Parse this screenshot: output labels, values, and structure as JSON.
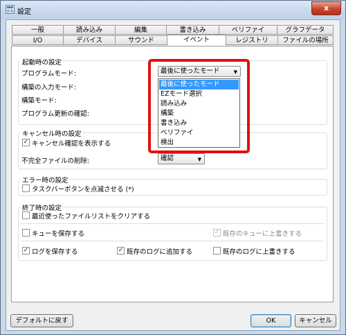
{
  "window": {
    "title": "設定",
    "close_label": "x"
  },
  "tabs_row1": [
    "一般",
    "読み込み",
    "編集",
    "書き込み",
    "ベリファイ",
    "グラフデータ"
  ],
  "tabs_row2": [
    "I/O",
    "デバイス",
    "サウンド",
    "イベント",
    "レジストリ",
    "ファイルの場所"
  ],
  "active_tab": "イベント",
  "startup": {
    "title": "起動時の設定",
    "program_mode_label": "プログラムモード:",
    "program_mode_value": "最後に使ったモード",
    "edit_input_mode_label": "構築の入力モード:",
    "edit_mode_label": "構築モード:",
    "program_update_label": "プログラム更新の確認:"
  },
  "dropdown_options": [
    "最後に使ったモード",
    "EZモード選択",
    "読み込み",
    "構築",
    "書き込み",
    "ベリファイ",
    "検出"
  ],
  "dropdown_selected": 0,
  "cancel": {
    "title": "キャンセル時の設定",
    "show_confirm_label": "キャンセル確認を表示する",
    "show_confirm_checked": true,
    "delete_incomplete_label": "不完全ファイルの削除:",
    "delete_incomplete_value": "確認"
  },
  "error": {
    "title": "エラー時の設定",
    "flash_taskbar_label": "タスクバーボタンを点滅させる (*)",
    "flash_taskbar_checked": false
  },
  "exit": {
    "title": "終了時の設定",
    "clear_recent_label": "最近使ったファイルリストをクリアする",
    "clear_recent_checked": false,
    "save_queue_label": "キューを保存する",
    "save_queue_checked": false,
    "overwrite_queue_label": "既存のキューに上書きする",
    "overwrite_queue_checked": true,
    "save_log_label": "ログを保存する",
    "save_log_checked": true,
    "append_log_label": "既存のログに追加する",
    "append_log_checked": true,
    "overwrite_log_label": "既存のログに上書きする",
    "overwrite_log_checked": false
  },
  "buttons": {
    "defaults": "デフォルトに戻す",
    "ok": "OK",
    "cancel": "キャンセル"
  },
  "colors": {
    "highlight": "#3399ff",
    "annotation_border": "#e01010",
    "close_button": "#c8452c"
  }
}
